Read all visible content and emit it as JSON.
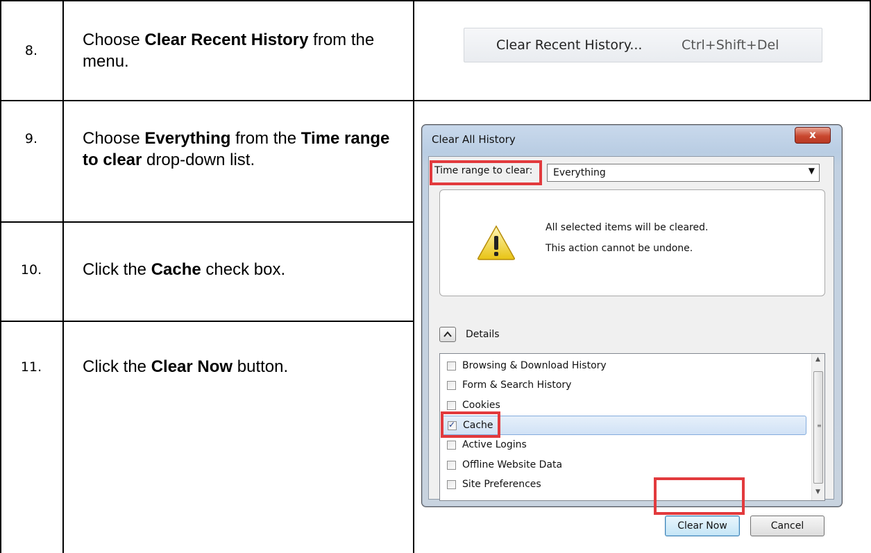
{
  "steps": [
    {
      "num": "8.",
      "text_pre": "Choose ",
      "bold": "Clear Recent History",
      "text_post": " from the menu."
    },
    {
      "num": "9.",
      "text_pre": "Choose ",
      "bold": "Everything",
      "text_mid": " from the ",
      "bold2": "Time range to clear",
      "text_post": " drop-down list."
    },
    {
      "num": "10.",
      "text_pre": "Click the ",
      "bold": "Cache",
      "text_post": " check box."
    },
    {
      "num": "11.",
      "text_pre": "Click the ",
      "bold": "Clear Now",
      "text_post": " button."
    }
  ],
  "menu_item": {
    "label": "Clear Recent History...",
    "shortcut": "Ctrl+Shift+Del"
  },
  "dialog": {
    "title": "Clear All History",
    "close_glyph": "x",
    "time_range_label": "Time range to clear:",
    "time_range_value": "Everything",
    "warning_line1": "All selected items will be cleared.",
    "warning_line2": "This action cannot be undone.",
    "details_label": "Details",
    "items": [
      {
        "label": "Browsing & Download History",
        "checked": false
      },
      {
        "label": "Form & Search History",
        "checked": false
      },
      {
        "label": "Cookies",
        "checked": false
      },
      {
        "label": "Cache",
        "checked": true
      },
      {
        "label": "Active Logins",
        "checked": false
      },
      {
        "label": "Offline Website Data",
        "checked": false
      },
      {
        "label": "Site Preferences",
        "checked": false
      }
    ],
    "clear_now_label": "Clear Now",
    "cancel_label": "Cancel"
  },
  "colors": {
    "highlight": "#e23a3d",
    "selected_row": "#d1e2f6",
    "close_button": "#c9472f"
  }
}
